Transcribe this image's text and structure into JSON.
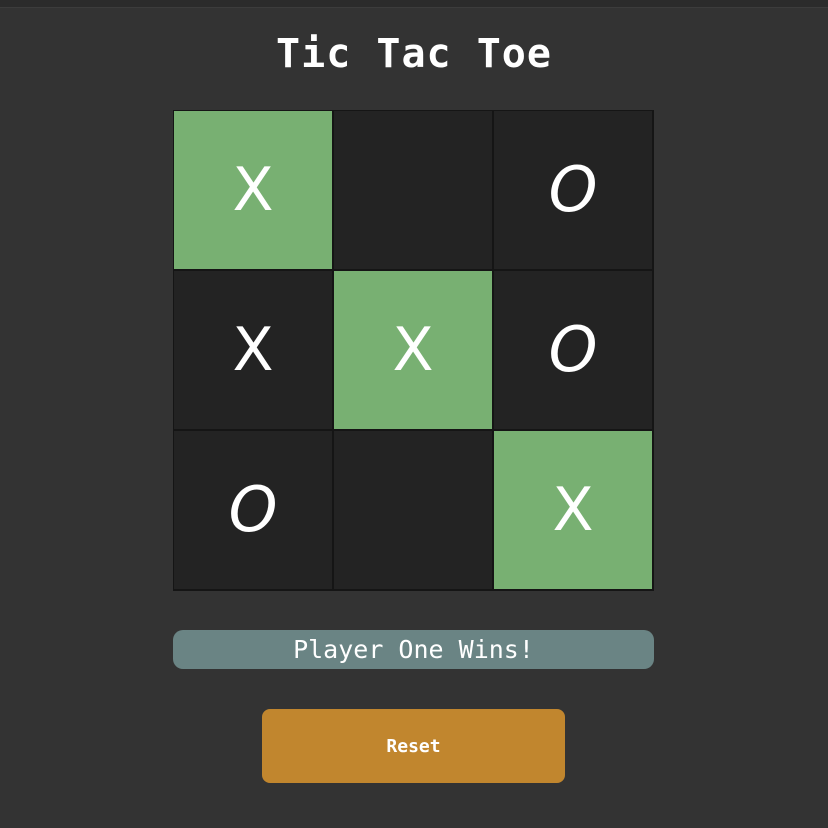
{
  "title": "Tic Tac Toe",
  "board": {
    "cells": [
      {
        "mark": "X",
        "winning": true
      },
      {
        "mark": "",
        "winning": false
      },
      {
        "mark": "O",
        "winning": false
      },
      {
        "mark": "X",
        "winning": false
      },
      {
        "mark": "X",
        "winning": true
      },
      {
        "mark": "O",
        "winning": false
      },
      {
        "mark": "O",
        "winning": false
      },
      {
        "mark": "",
        "winning": false
      },
      {
        "mark": "X",
        "winning": true
      }
    ]
  },
  "status": "Player One Wins!",
  "reset_label": "Reset",
  "colors": {
    "background": "#333333",
    "cell": "#232323",
    "winning_cell": "#78b072",
    "status_bar": "#6a8484",
    "reset_button": "#c1862e"
  }
}
